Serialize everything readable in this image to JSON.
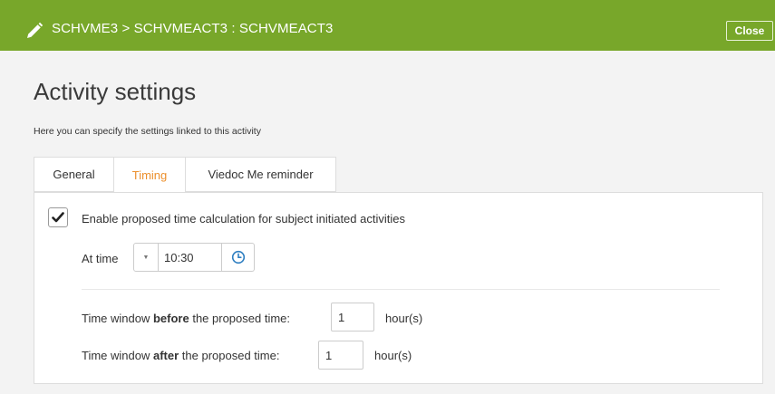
{
  "header": {
    "breadcrumb": "SCHVME3 > SCHVMEACT3 : SCHVMEACT3",
    "close_label": "Close",
    "accent_color": "#78a72a"
  },
  "page": {
    "title": "Activity settings",
    "subtitle": "Here you can specify the settings linked to this activity"
  },
  "tabs": [
    {
      "label": "General",
      "active": false
    },
    {
      "label": "Timing",
      "active": true
    },
    {
      "label": "Viedoc Me reminder",
      "active": false
    }
  ],
  "timing": {
    "enable_checked": true,
    "enable_label": "Enable proposed time calculation for subject initiated activities",
    "at_time_label": "At time",
    "at_time_value": "10:30",
    "before_prefix": "Time window ",
    "before_bold": "before",
    "before_suffix": " the proposed time:",
    "before_value": "1",
    "after_prefix": "Time window ",
    "after_bold": "after",
    "after_suffix": " the proposed time:",
    "after_value": "1",
    "unit_label": "hour(s)"
  },
  "icons": {
    "header": "pencil-icon",
    "checkbox": "checkmark-icon",
    "dropdown": "caret-down-icon",
    "time": "clock-icon"
  },
  "colors": {
    "active_tab": "#ec8f2c",
    "clock_icon": "#2f7fc1"
  }
}
